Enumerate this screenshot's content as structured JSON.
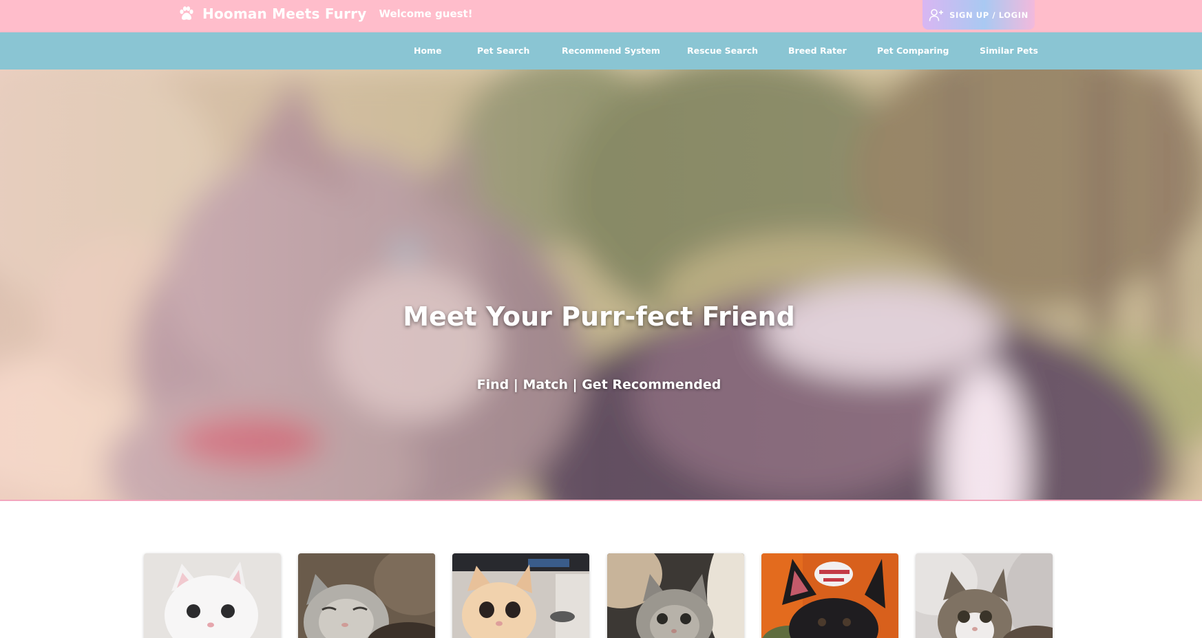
{
  "header": {
    "brand": "Hooman Meets Furry",
    "welcome": "Welcome guest!",
    "signup_label": "SIGN UP / LOGIN",
    "bg_color": "#ffbdcb"
  },
  "nav": {
    "bg_color": "#8ac5d3",
    "items": [
      {
        "label": "Home"
      },
      {
        "label": "Pet Search"
      },
      {
        "label": "Recommend System"
      },
      {
        "label": "Rescue Search"
      },
      {
        "label": "Breed Rater"
      },
      {
        "label": "Pet Comparing"
      },
      {
        "label": "Similar Pets"
      }
    ]
  },
  "hero": {
    "title": "Meet Your Purr-fect Friend",
    "subtitle": "Find | Match | Get Recommended"
  },
  "pets": [
    {
      "name": "white-cat-photo"
    },
    {
      "name": "tabby-cat-squinting-photo"
    },
    {
      "name": "orange-kitten-photo"
    },
    {
      "name": "grey-tabby-cat-photo"
    },
    {
      "name": "black-dog-with-toy-photo"
    },
    {
      "name": "tabby-white-cat-photo"
    }
  ]
}
